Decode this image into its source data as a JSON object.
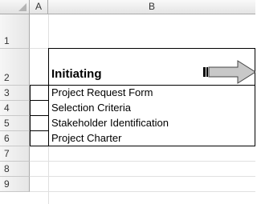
{
  "columns": {
    "a": "A",
    "b": "B"
  },
  "rows": [
    "1",
    "2",
    "3",
    "4",
    "5",
    "6",
    "7",
    "8",
    "9"
  ],
  "title": "Initiating",
  "items": [
    "Project Request Form",
    "Selection Criteria",
    "Stakeholder Identification",
    "Project Charter"
  ]
}
